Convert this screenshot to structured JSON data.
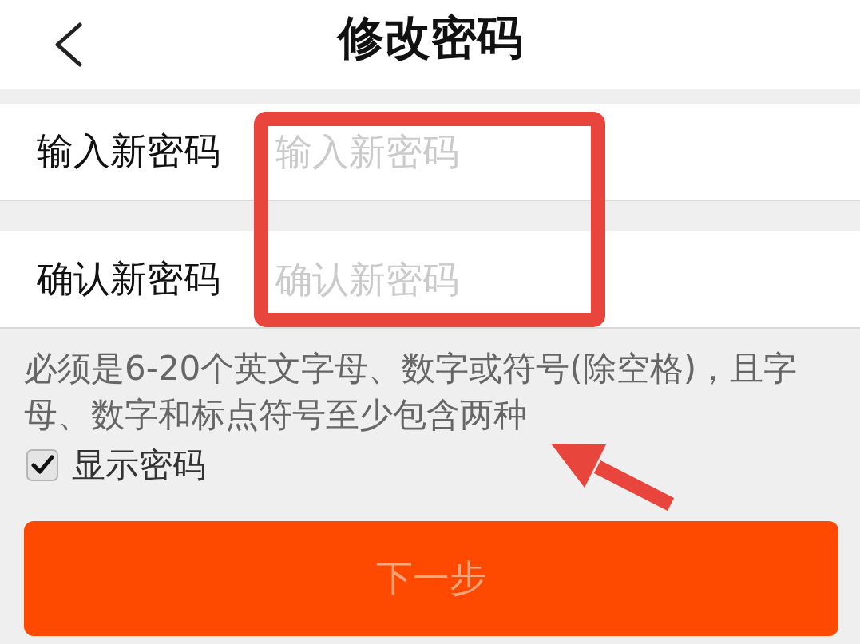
{
  "header": {
    "title": "修改密码"
  },
  "fields": [
    {
      "label": "输入新密码",
      "placeholder": "输入新密码"
    },
    {
      "label": "确认新密码",
      "placeholder": "确认新密码"
    }
  ],
  "hint": "必须是6-20个英文字母、数字或符号(除空格)，且字母、数字和标点符号至少包含两种",
  "show_password": {
    "label": "显示密码",
    "checked": true
  },
  "next_button": {
    "label": "下一步",
    "disabled": true
  }
}
